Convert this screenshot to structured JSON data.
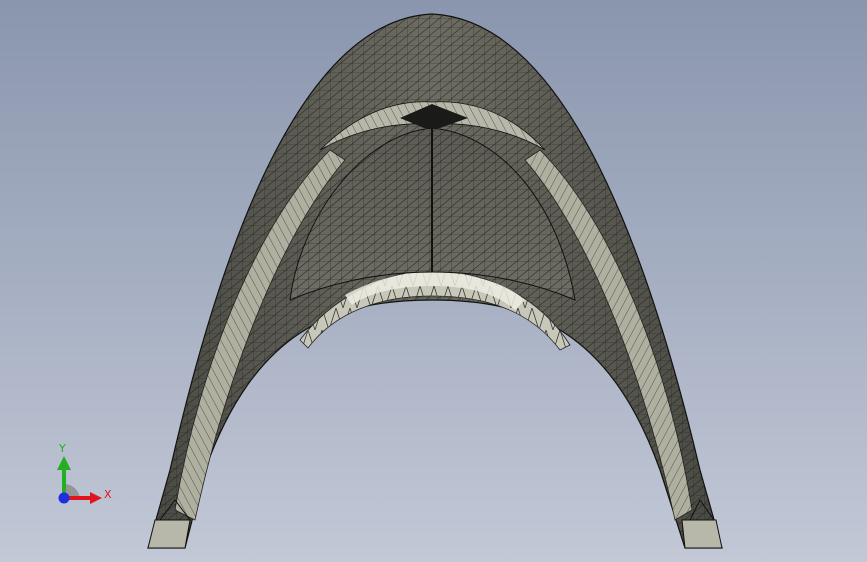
{
  "viewport": {
    "background_top": "#8a96ae",
    "background_bottom": "#c2c8d6",
    "model": {
      "shell_color": "#5e5e55",
      "face_light": "#d8d8cc",
      "face_mid": "#a8a898",
      "mesh_line_color": "#1a1a18"
    }
  },
  "triad": {
    "x_label": "X",
    "y_label": "Y",
    "x_color": "#e0141e",
    "y_color": "#22b022",
    "z_color": "#1e2ee0"
  }
}
